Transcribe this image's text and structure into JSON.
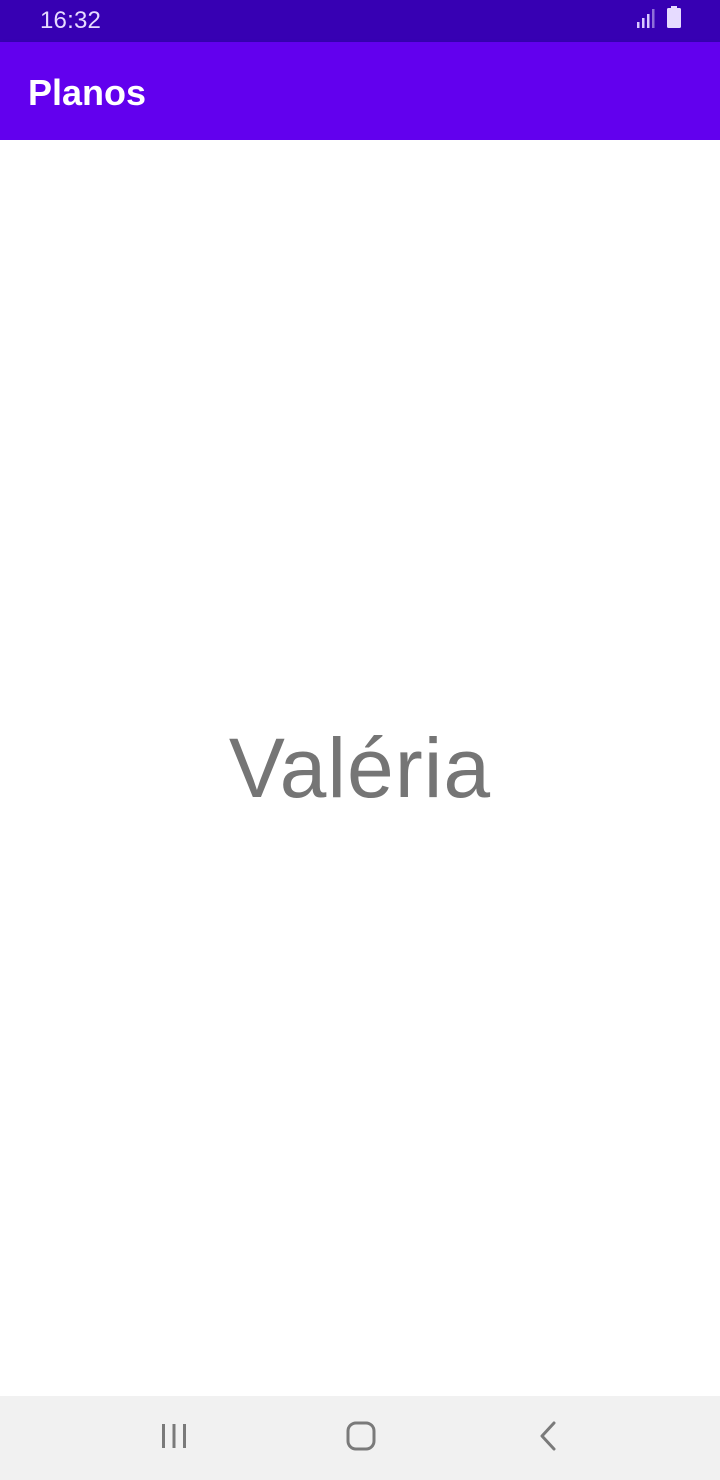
{
  "status_bar": {
    "time": "16:32",
    "icons": [
      "signal-icon",
      "battery-icon"
    ]
  },
  "app_bar": {
    "title": "Planos"
  },
  "content": {
    "name": "Valéria"
  },
  "nav_bar": {
    "buttons": [
      "recents-icon",
      "home-icon",
      "back-icon"
    ]
  },
  "colors": {
    "status_bar": "#3700b3",
    "app_bar": "#6200ee",
    "text_primary": "#757575",
    "nav_bar": "#f1f1f1"
  }
}
